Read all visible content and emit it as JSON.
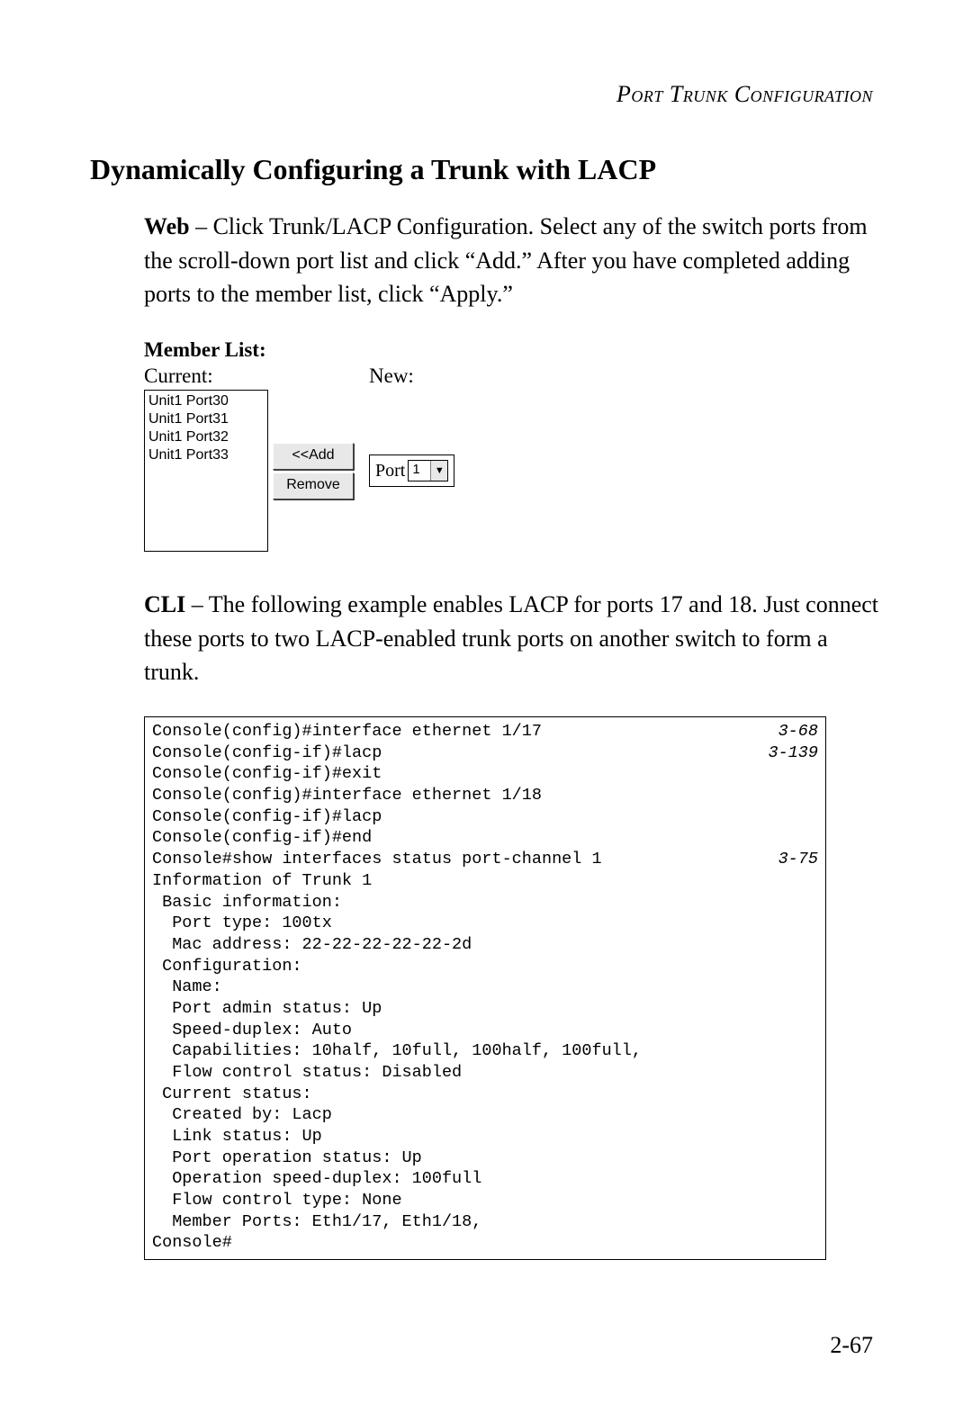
{
  "header": {
    "running_title": "Port Trunk Configuration"
  },
  "section": {
    "title": "Dynamically Configuring a Trunk with LACP",
    "web_label": "Web",
    "web_text": " – Click Trunk/LACP Configuration. Select any of the switch ports from the scroll-down port list and click “Add.” After you have completed adding ports to the member list, click “Apply.”",
    "cli_label": "CLI",
    "cli_text": " – The following example enables LACP for ports 17 and 18. Just connect these ports to two LACP-enabled trunk ports on another switch to form a trunk."
  },
  "ui": {
    "member_list_label": "Member List:",
    "current_label": "Current:",
    "new_label": "New:",
    "listbox_items": [
      "Unit1 Port30",
      "Unit1 Port31",
      "Unit1 Port32",
      "Unit1 Port33"
    ],
    "add_button": "<<Add",
    "remove_button": "Remove",
    "port_label": "Port",
    "port_value": "1"
  },
  "cli": {
    "lines": [
      {
        "cmd": "Console(config)#interface ethernet 1/17",
        "ref": "3-68"
      },
      {
        "cmd": "Console(config-if)#lacp",
        "ref": "3-139"
      },
      {
        "cmd": "Console(config-if)#exit",
        "ref": ""
      },
      {
        "cmd": "Console(config)#interface ethernet 1/18",
        "ref": ""
      },
      {
        "cmd": "Console(config-if)#lacp",
        "ref": ""
      },
      {
        "cmd": "Console(config-if)#end",
        "ref": ""
      },
      {
        "cmd": "Console#show interfaces status port-channel 1",
        "ref": "3-75"
      },
      {
        "cmd": "Information of Trunk 1",
        "ref": ""
      },
      {
        "cmd": " Basic information:",
        "ref": ""
      },
      {
        "cmd": "  Port type: 100tx",
        "ref": ""
      },
      {
        "cmd": "  Mac address: 22-22-22-22-22-2d",
        "ref": ""
      },
      {
        "cmd": " Configuration:",
        "ref": ""
      },
      {
        "cmd": "  Name:",
        "ref": ""
      },
      {
        "cmd": "  Port admin status: Up",
        "ref": ""
      },
      {
        "cmd": "  Speed-duplex: Auto",
        "ref": ""
      },
      {
        "cmd": "  Capabilities: 10half, 10full, 100half, 100full,",
        "ref": ""
      },
      {
        "cmd": "  Flow control status: Disabled",
        "ref": ""
      },
      {
        "cmd": " Current status:",
        "ref": ""
      },
      {
        "cmd": "  Created by: Lacp",
        "ref": ""
      },
      {
        "cmd": "  Link status: Up",
        "ref": ""
      },
      {
        "cmd": "  Port operation status: Up",
        "ref": ""
      },
      {
        "cmd": "  Operation speed-duplex: 100full",
        "ref": ""
      },
      {
        "cmd": "  Flow control type: None",
        "ref": ""
      },
      {
        "cmd": "  Member Ports: Eth1/17, Eth1/18,",
        "ref": ""
      },
      {
        "cmd": "Console#",
        "ref": ""
      }
    ]
  },
  "footer": {
    "page_number": "2-67"
  }
}
